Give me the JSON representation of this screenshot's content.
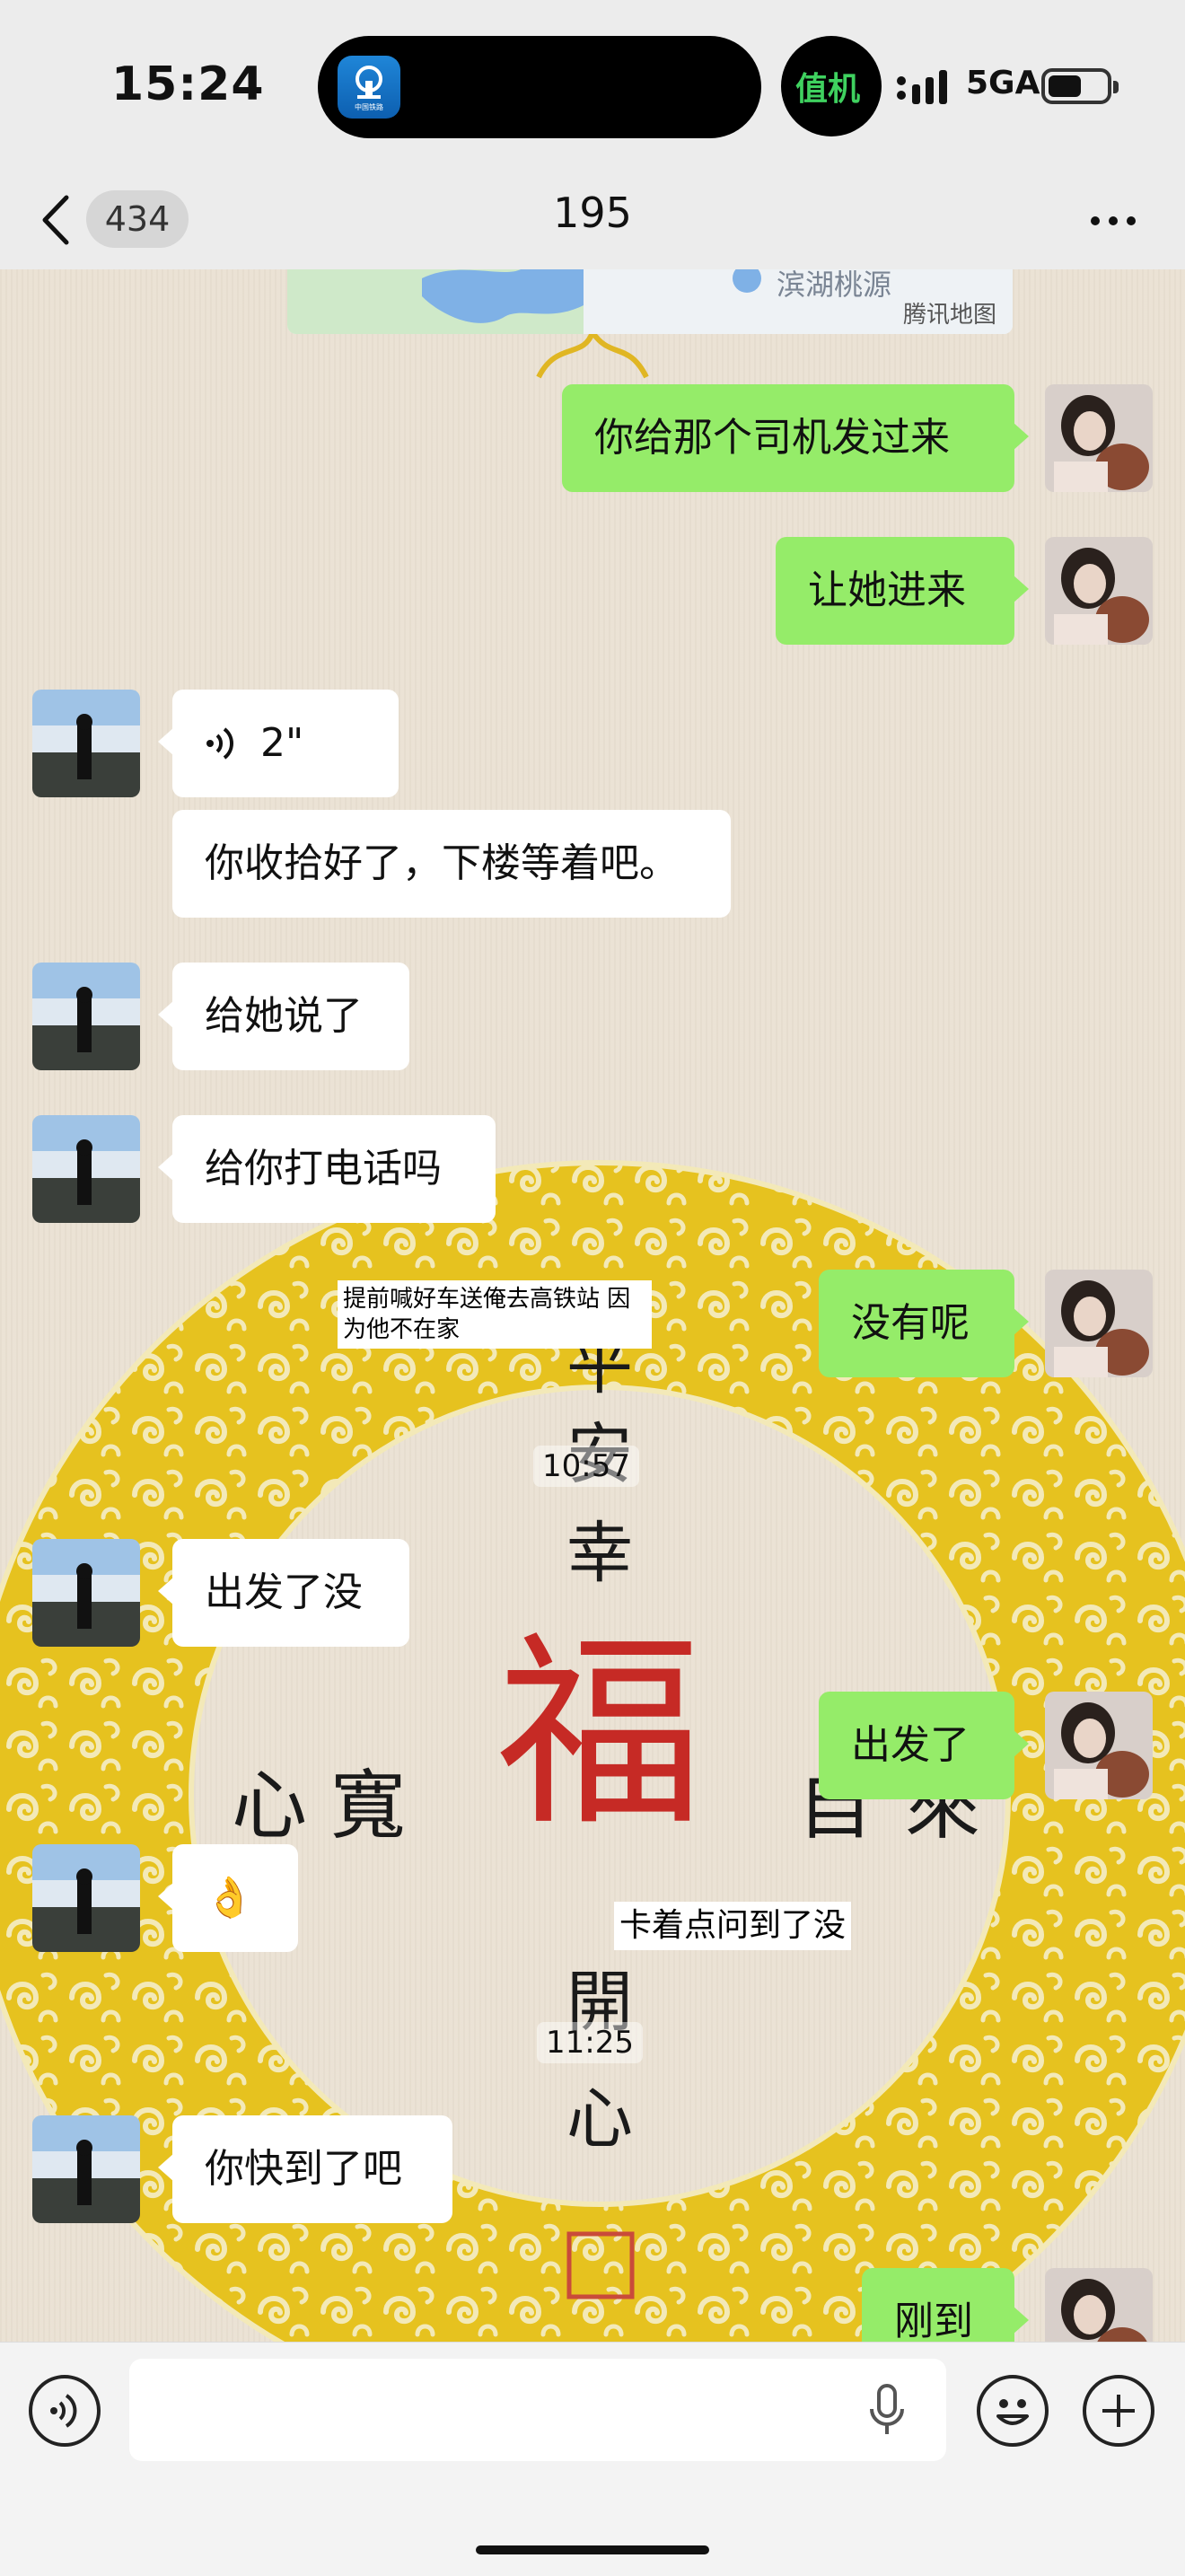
{
  "status_bar": {
    "time": "15:24",
    "app_icon_label": "中国铁路",
    "live_activity": "值机",
    "network": "5GA"
  },
  "nav": {
    "unread_count": "434",
    "title": "195"
  },
  "map_card": {
    "place": "滨湖桃源",
    "provider": "腾讯地图"
  },
  "messages": [
    {
      "side": "me",
      "type": "text",
      "text": "你给那个司机发过来"
    },
    {
      "side": "me",
      "type": "text",
      "text": "让她进来"
    },
    {
      "side": "other",
      "type": "voice",
      "duration": "2\""
    },
    {
      "side": "other",
      "type": "text",
      "text": "你收拾好了，下楼等着吧。"
    },
    {
      "side": "other",
      "type": "text",
      "text": "给她说了"
    },
    {
      "side": "other",
      "type": "text",
      "text": "给你打电话吗"
    },
    {
      "side": "me",
      "type": "text",
      "text": "没有呢"
    },
    {
      "side": "other",
      "type": "text",
      "text": "出发了没"
    },
    {
      "side": "me",
      "type": "text",
      "text": "出发了"
    },
    {
      "side": "other",
      "type": "emoji",
      "text": "👌"
    },
    {
      "side": "other",
      "type": "text",
      "text": "你快到了吧"
    },
    {
      "side": "me",
      "type": "text",
      "text": "刚到"
    }
  ],
  "timestamps": [
    "10:57",
    "11:25"
  ],
  "annotations": [
    "提前喊好车送俺去高铁站 因为他不在家",
    "卡着点问到了没"
  ],
  "wallpaper": {
    "characters": [
      "平",
      "安",
      "幸",
      "福",
      "心",
      "寬",
      "自",
      "來",
      "開",
      "心"
    ],
    "colors": {
      "ring": "#e6c21f",
      "fu": "#c62a25",
      "ink": "#1a1a1a"
    }
  },
  "colors": {
    "my_bubble": "#95ec69",
    "other_bubble": "#ffffff"
  },
  "icons": [
    "back-chevron-icon",
    "more-icon",
    "voice-input-icon",
    "microphone-icon",
    "emoji-icon",
    "add-icon",
    "voice-wave-icon"
  ]
}
